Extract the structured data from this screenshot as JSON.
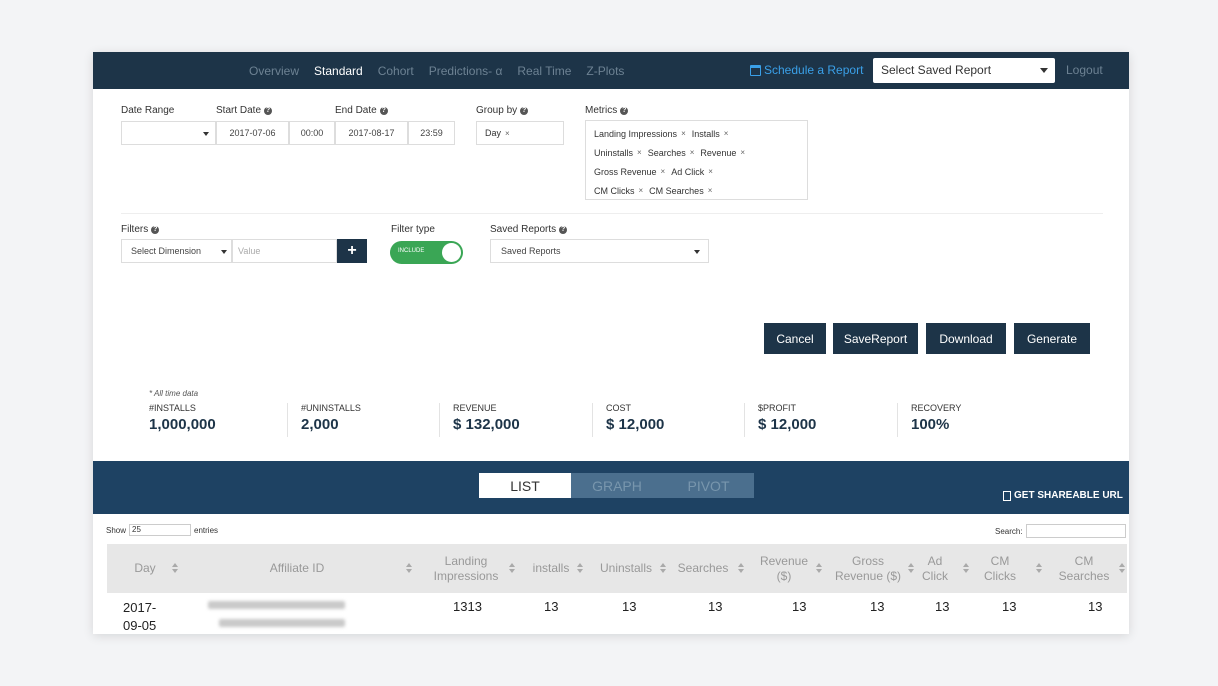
{
  "nav": {
    "items": [
      "Overview",
      "Standard",
      "Cohort",
      "Predictions- α",
      "Real Time",
      "Z-Plots"
    ],
    "schedule": "Schedule a Report",
    "saved_select": "Select Saved Report",
    "logout": "Logout"
  },
  "form": {
    "date_range_label": "Date Range",
    "date_range_value": "",
    "start_date_label": "Start Date",
    "start_date": "2017-07-06",
    "start_time": "00:00",
    "end_date_label": "End Date",
    "end_date": "2017-08-17",
    "end_time": "23:59",
    "group_by_label": "Group by",
    "group_by_value": "Day",
    "metrics_label": "Metrics",
    "metrics": [
      "Landing Impressions",
      "Installs",
      "Uninstalls",
      "Searches",
      "Revenue",
      "Gross Revenue",
      "Ad Click",
      "CM Clicks",
      "CM Searches"
    ],
    "tag_remove": "×",
    "filters_label": "Filters",
    "dimension_placeholder": "Select Dimension",
    "value_placeholder": "Value",
    "plus": "+",
    "filter_type_label": "Filter type",
    "filter_type_value": "INCLUDE",
    "saved_reports_label": "Saved Reports",
    "saved_reports_value": "Saved Reports",
    "help_glyph": "?"
  },
  "buttons": {
    "cancel": "Cancel",
    "save_report": "SaveReport",
    "download": "Download",
    "generate": "Generate"
  },
  "stats": {
    "note": "* All time data",
    "items": [
      {
        "label": "#INSTALLS",
        "value": "1,000,000"
      },
      {
        "label": "#UNINSTALLS",
        "value": "2,000"
      },
      {
        "label": "REVENUE",
        "value": "$ 132,000"
      },
      {
        "label": "COST",
        "value": "$ 12,000"
      },
      {
        "label": "$PROFIT",
        "value": "$ 12,000"
      },
      {
        "label": "RECOVERY",
        "value": "100%"
      }
    ]
  },
  "views": {
    "list": "LIST",
    "graph": "GRAPH",
    "pivot": "PIVOT",
    "active": "LIST",
    "share": "GET SHAREABLE URL"
  },
  "table": {
    "show_label": "Show",
    "show_value": "25",
    "entries_label": "entries",
    "search_label": "Search:",
    "columns": [
      "Day",
      "Affiliate ID",
      "Landing Impressions",
      "installs",
      "Uninstalls",
      "Searches",
      "Revenue ($)",
      "Gross Revenue ($)",
      "Ad Click",
      "CM Clicks",
      "CM Searches"
    ],
    "rows": [
      {
        "day": "2017-09-05",
        "landing_impressions": "1313",
        "installs": "13",
        "uninstalls": "13",
        "searches": "13",
        "revenue": "13",
        "gross_revenue": "13",
        "ad_click": "13",
        "cm_clicks": "13",
        "cm_searches": "13"
      }
    ]
  },
  "colors": {
    "nav_bg": "#1d3448",
    "accent_blue": "#3aa0e8",
    "band_bg": "#1e4263",
    "toggle_green": "#3aa655"
  }
}
